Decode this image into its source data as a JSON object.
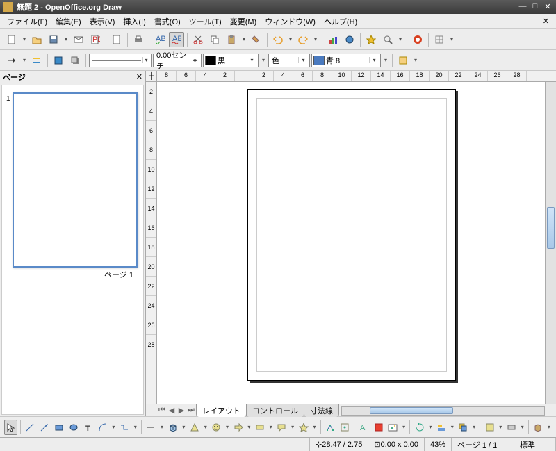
{
  "titlebar": {
    "title": "無題 2 - OpenOffice.org Draw"
  },
  "menubar": {
    "items": [
      "ファイル(F)",
      "編集(E)",
      "表示(V)",
      "挿入(I)",
      "書式(O)",
      "ツール(T)",
      "変更(M)",
      "ウィンドウ(W)",
      "ヘルプ(H)"
    ]
  },
  "toolbar2": {
    "width": {
      "value": "0.00センチ"
    },
    "lineColor": {
      "label": "黒",
      "swatch": "#000000"
    },
    "fillType": {
      "label": "色"
    },
    "fillColor": {
      "label": "青 8",
      "swatch": "#4a7abf"
    }
  },
  "panel": {
    "title": "ページ",
    "page_label": "ページ 1",
    "page_num": "1"
  },
  "ruler": {
    "h": [
      "8",
      "6",
      "4",
      "2",
      "",
      "2",
      "4",
      "6",
      "8",
      "10",
      "12",
      "14",
      "16",
      "18",
      "20",
      "22",
      "24",
      "26",
      "28"
    ],
    "v": [
      "2",
      "4",
      "6",
      "8",
      "10",
      "12",
      "14",
      "16",
      "18",
      "20",
      "22",
      "24",
      "26",
      "28"
    ]
  },
  "tabs": {
    "items": [
      "レイアウト",
      "コントロール",
      "寸法線"
    ]
  },
  "status": {
    "pos": "28.47 / 2.75",
    "size": "0.00 x 0.00",
    "zoom": "43%",
    "page": "ページ 1 / 1",
    "mode": "標準"
  }
}
